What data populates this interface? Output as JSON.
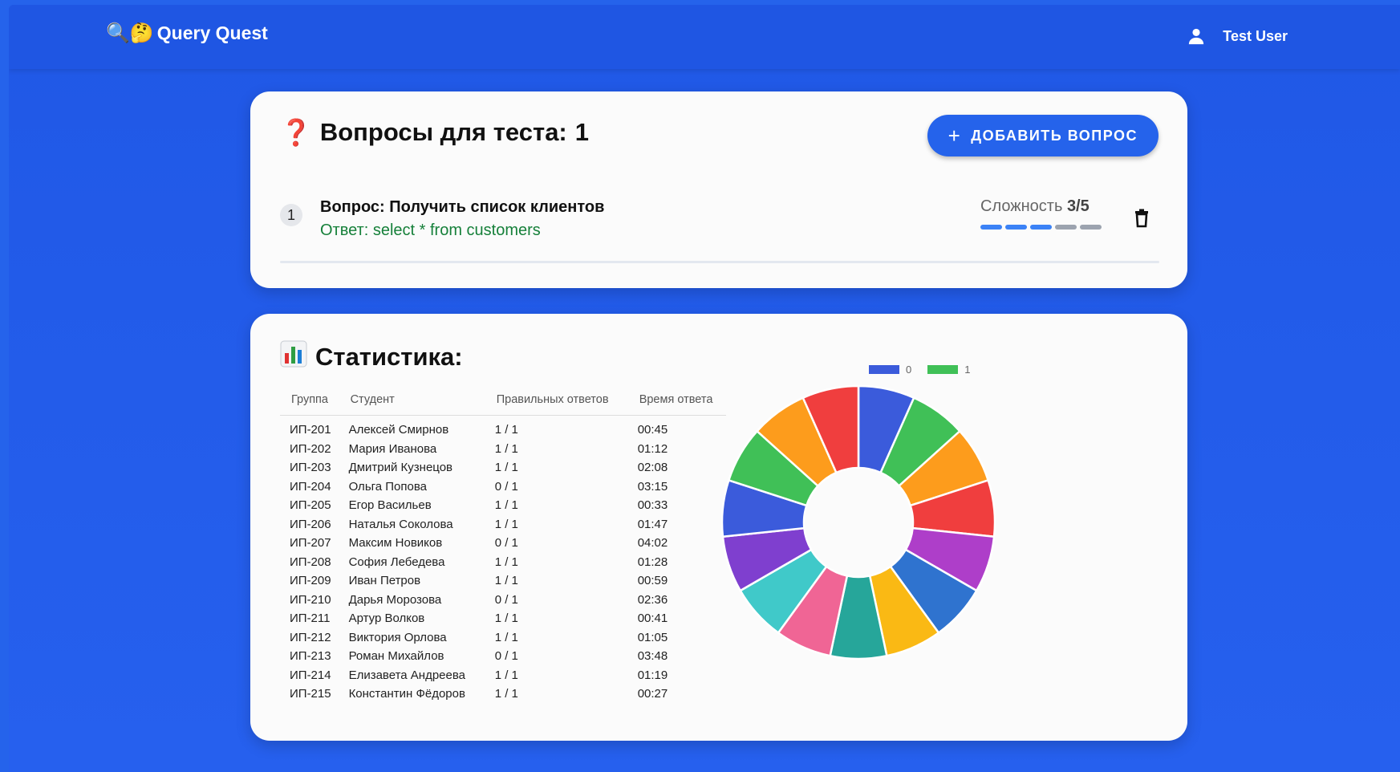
{
  "header": {
    "brand_emoji": "🔍🤔",
    "brand_title": "Query Quest",
    "user_name": "Test User"
  },
  "questions_card": {
    "title_prefix": "Вопросы для теста:",
    "count": "1",
    "add_button_label": "ДОБАВИТЬ ВОПРОС",
    "items": [
      {
        "number": "1",
        "question": "Вопрос: Получить список клиентов",
        "answer": "Ответ: select * from customers",
        "difficulty_label": "Сложность",
        "difficulty_value": "3/5",
        "difficulty_level": 3,
        "difficulty_max": 5
      }
    ]
  },
  "stats_card": {
    "title": "Статистика:",
    "columns": [
      "Группа",
      "Студент",
      "Правильных ответов",
      "Время ответа"
    ],
    "rows": [
      [
        "ИП-201",
        "Алексей Смирнов",
        "1 / 1",
        "00:45"
      ],
      [
        "ИП-202",
        "Мария Иванова",
        "1 / 1",
        "01:12"
      ],
      [
        "ИП-203",
        "Дмитрий Кузнецов",
        "1 / 1",
        "02:08"
      ],
      [
        "ИП-204",
        "Ольга Попова",
        "0 / 1",
        "03:15"
      ],
      [
        "ИП-205",
        "Егор Васильев",
        "1 / 1",
        "00:33"
      ],
      [
        "ИП-206",
        "Наталья Соколова",
        "1 / 1",
        "01:47"
      ],
      [
        "ИП-207",
        "Максим Новиков",
        "0 / 1",
        "04:02"
      ],
      [
        "ИП-208",
        "София Лебедева",
        "1 / 1",
        "01:28"
      ],
      [
        "ИП-209",
        "Иван Петров",
        "1 / 1",
        "00:59"
      ],
      [
        "ИП-210",
        "Дарья Морозова",
        "0 / 1",
        "02:36"
      ],
      [
        "ИП-211",
        "Артур Волков",
        "1 / 1",
        "00:41"
      ],
      [
        "ИП-212",
        "Виктория Орлова",
        "1 / 1",
        "01:05"
      ],
      [
        "ИП-213",
        "Роман Михайлов",
        "0 / 1",
        "03:48"
      ],
      [
        "ИП-214",
        "Елизавета Андреева",
        "1 / 1",
        "01:19"
      ],
      [
        "ИП-215",
        "Константин Фёдоров",
        "1 / 1",
        "00:27"
      ]
    ]
  },
  "chart_data": {
    "type": "pie",
    "donut": true,
    "legend": [
      "0",
      "1"
    ],
    "legend_colors": [
      "#3b5bdb",
      "#40c057"
    ],
    "legend_placement": "top",
    "values": [
      1,
      1,
      1,
      1,
      1,
      1,
      1,
      1,
      1,
      1,
      1,
      1,
      1,
      1,
      1
    ],
    "colors": [
      "#3b5bdb",
      "#40c057",
      "#fd9c1c",
      "#f03e3e",
      "#ae3ec9",
      "#2f73cf",
      "#fab914",
      "#26a69a",
      "#f06595",
      "#40c9c9",
      "#7f3fcf",
      "#3b5bdb",
      "#40c057",
      "#fd9c1c",
      "#f03e3e"
    ]
  },
  "colors": {
    "accent": "#2563eb",
    "answer_green": "#16803a",
    "difficulty_on": "#3b82f6",
    "difficulty_off": "#9ca3af"
  },
  "icons": {
    "user": "user-icon",
    "add": "plus-icon",
    "delete": "trash-icon",
    "stats": "bar-chart-icon",
    "question": "question-mark-icon"
  }
}
